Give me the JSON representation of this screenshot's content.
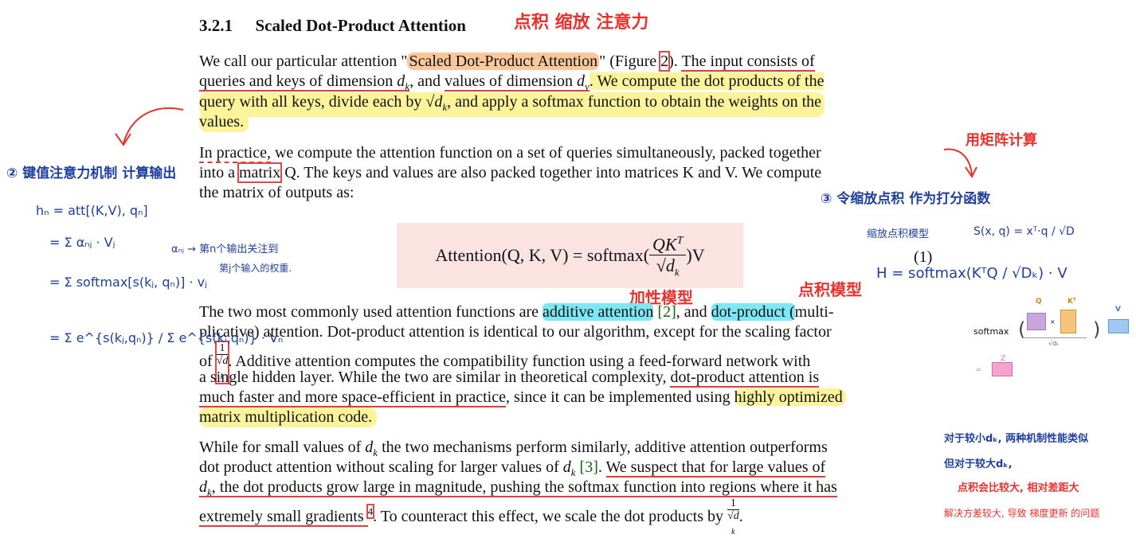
{
  "heading": {
    "number": "3.2.1",
    "title": "Scaled Dot-Product Attention",
    "annotation": "点积 缩放 注意力"
  },
  "para1": {
    "l1_a": "We call our particular attention \"",
    "l1_hl": "Scaled Dot-Product Attention",
    "l1_b": "\" (Figure ",
    "l1_ref": "2",
    "l1_c": ").  ",
    "l1_d": "The input consists of",
    "l2_a": "queries and keys of dimension ",
    "l2_dk": "d",
    "l2_sub": "k",
    "l2_b": ", and ",
    "l2_c": "values of dimension ",
    "l2_dv": "d",
    "l2_vsub": "v",
    "l2_d": ". We compute the dot products of the",
    "l3_a": "query with all keys, divide each by ",
    "l3_b": "√d",
    "l3_sub": "k",
    "l3_c": ", and apply a softmax function to obtain the weights on the",
    "l4": "values."
  },
  "para2": {
    "l1_a": "In practice,",
    "l1_b": " we compute the attention function on a set of queries simultaneously, packed together",
    "l2_a": "into a ",
    "l2_box": "matrix",
    "l2_b": " Q. The keys and values are also packed together into matrices K and V. We compute",
    "l3": "the matrix of outputs as:"
  },
  "formula": {
    "text": "Attention(Q, K, V) = softmax(",
    "num": "QK",
    "sup": "T",
    "den": "√d",
    "densub": "k",
    "tail": ")V",
    "eq_number": "(1)"
  },
  "para3": {
    "l1_a": "The two most commonly used attention functions are ",
    "l1_hl1": "additive attention",
    "l1_ref": " [2]",
    "l1_b": ", and ",
    "l1_hl2": "dot-product (",
    "l1_c": "multi-",
    "l2": "plicative) attention. Dot-product attention is identical to our algorithm, except for the scaling factor",
    "l3_a": "of ",
    "l3_num": "1",
    "l3_den": "√d",
    "l3_densub": "k",
    "l3_b": ". Additive attention computes the compatibility function using a feed-forward network with",
    "l4_a": "a single hidden layer. While the two are similar in theoretical complexity, ",
    "l4_b": "dot-product attention is",
    "l5_a": "much faster and more space-efficient in practice",
    "l5_b": ", since it can be implemented using ",
    "l5_hl": "highly optimized",
    "l6": "matrix multiplication code."
  },
  "para4": {
    "l1_a": "While for small values of ",
    "l1_dk": "d",
    "l1_sub": "k",
    "l1_b": " the two mechanisms perform similarly, additive attention outperforms",
    "l2_a": "dot product attention without scaling for larger values of ",
    "l2_dk": "d",
    "l2_sub": "k",
    "l2_ref": " [3]",
    "l2_b": ". ",
    "l2_c": "We suspect that for large values of",
    "l3_dk": "d",
    "l3_sub": "k",
    "l3_a": ", the dot products grow large in magnitude, pushing the softmax function into regions where it has",
    "l4_a": "extremely small gradients ",
    "l4_fn": "4",
    "l4_b": ". To counteract this effect, we scale the dot products by ",
    "l4_num": "1",
    "l4_den": "√d",
    "l4_densub": "k",
    "l4_c": "."
  },
  "annotations": {
    "red_additive": "加性模型",
    "red_dot": "点积模型",
    "red_matrix_calc": "用矩阵计算",
    "blue_left_title": "② 键值注意力机制 计算输出",
    "blue_h1": "hₙ = att[(K,V), qₙ]",
    "blue_h2": "= Σ αₙⱼ · Vⱼ",
    "blue_h3": "= Σ softmax[s(kⱼ, qₙ)] · vⱼ",
    "blue_h4": "= Σ e^{s(kⱼ,qₙ)} / Σ e^{s(kᵢ,qₙ)} · Vₙ",
    "blue_alpha": "αₙⱼ → 第n个输出关注到",
    "blue_alpha2": "第j个输入的权重.",
    "blue_score": "③ 令缩放点积 作为打分函数",
    "blue_model": "缩放点积模型",
    "blue_s": "S(x, q) = xᵀ·q / √D",
    "blue_H": "H = softmax(KᵀQ / √Dₖ) · V",
    "red_right1": "对于较小dₖ, 两种机制性能类似",
    "red_right2": "但对于较大dₖ,",
    "red_right3": "点积会比较大, 相对差距大",
    "red_right4": "解决方差较大, 导致 梯度更新 的问题"
  },
  "softmax_panel": {
    "label": "softmax",
    "q": "Q",
    "kt": "Kᵀ",
    "v": "V",
    "z": "Z",
    "den": "√dₖ",
    "times": "×"
  }
}
